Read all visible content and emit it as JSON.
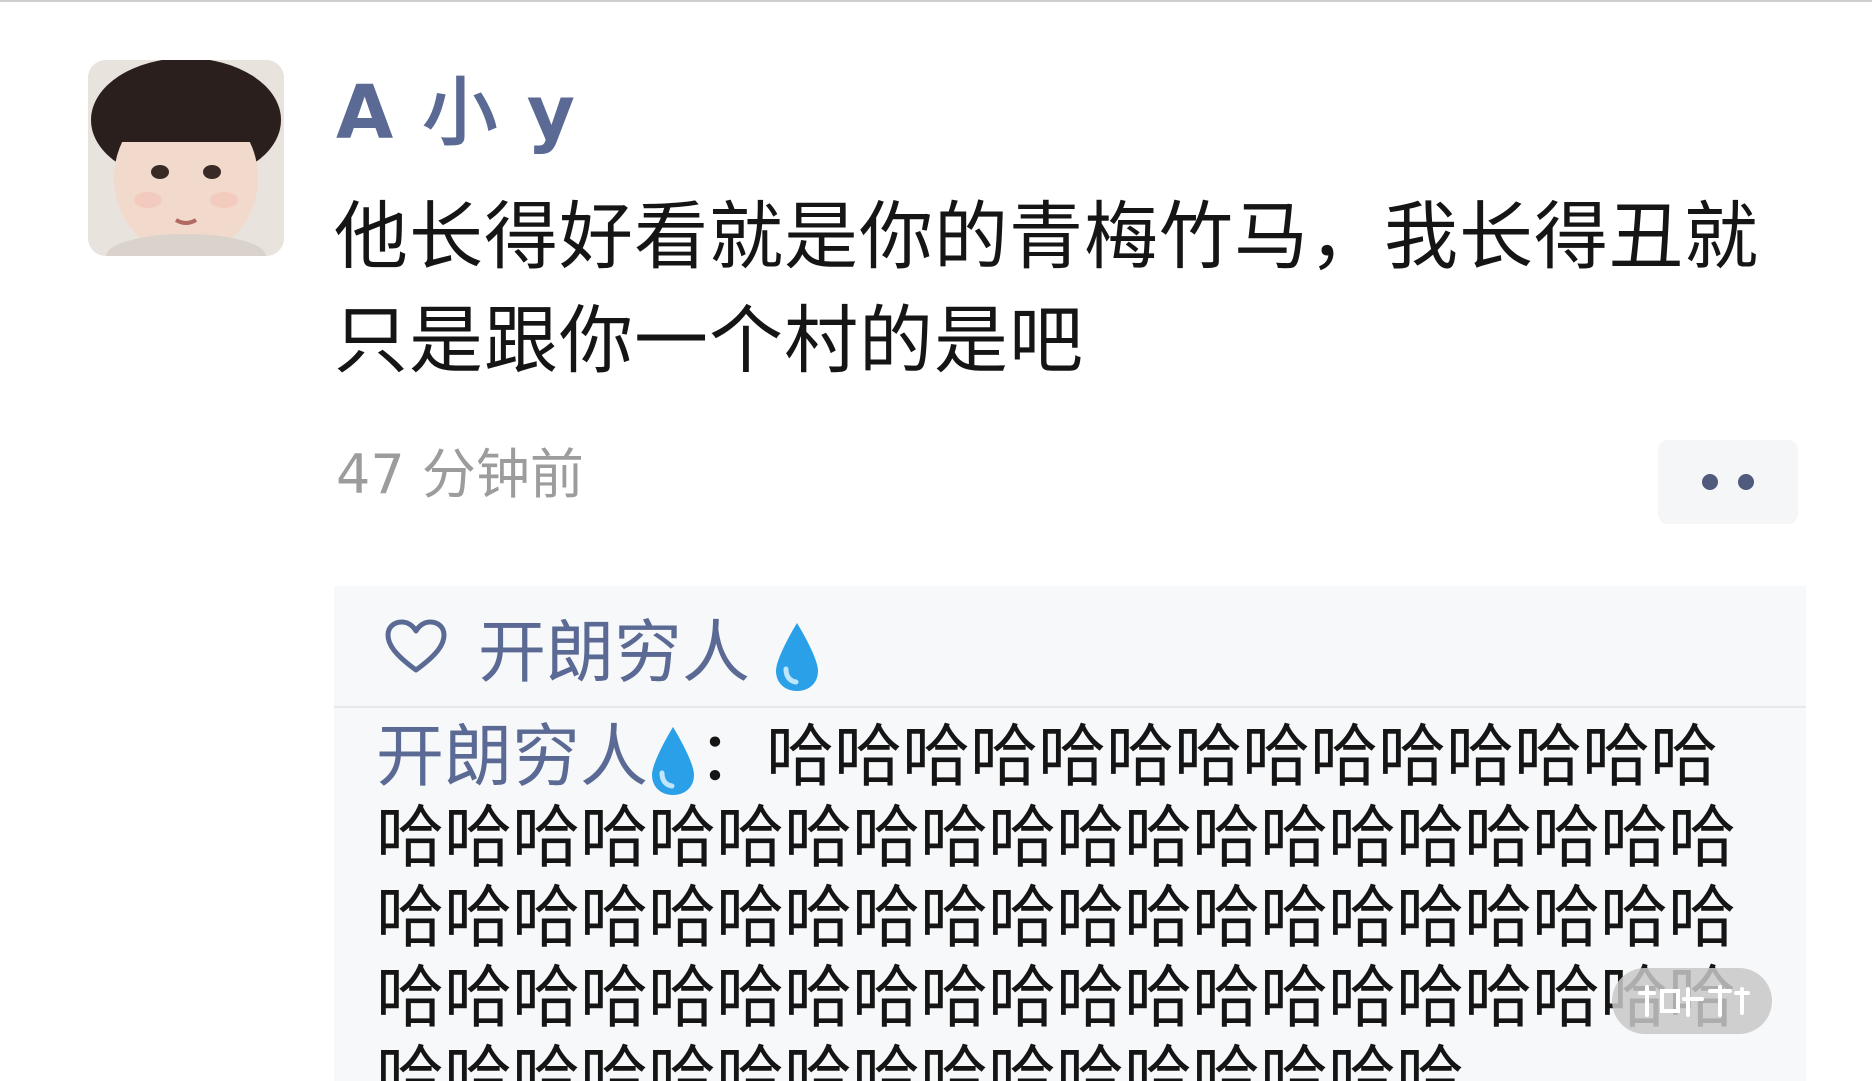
{
  "post": {
    "username": "A 小 y",
    "text": "他长得好看就是你的青梅竹马，我长得丑就只是跟你一个村的是吧",
    "timestamp": "47 分钟前",
    "more_icon": "ellipsis-icon"
  },
  "likes": {
    "icon": "heart-outline-icon",
    "names": [
      "开朗穷人"
    ],
    "name_suffix_icon": "droplet-emoji"
  },
  "comments": [
    {
      "author": "开朗穷人",
      "author_suffix_icon": "droplet-emoji",
      "separator": "：",
      "text": "哈哈哈哈哈哈哈哈哈哈哈哈哈哈哈哈哈哈哈哈哈哈哈哈哈哈哈哈哈哈哈哈哈哈哈哈哈哈哈哈哈哈哈哈哈哈哈哈哈哈哈哈哈哈哈哈哈哈哈哈哈哈哈哈哈哈哈哈哈哈哈哈哈哈哈哈哈哈哈哈哈哈哈哈哈哈哈哈哈哈"
    }
  ],
  "colors": {
    "name_blue": "#5b6a94",
    "timestamp_gray": "#9c9c9c",
    "droplet_blue": "#2aa0e8"
  }
}
